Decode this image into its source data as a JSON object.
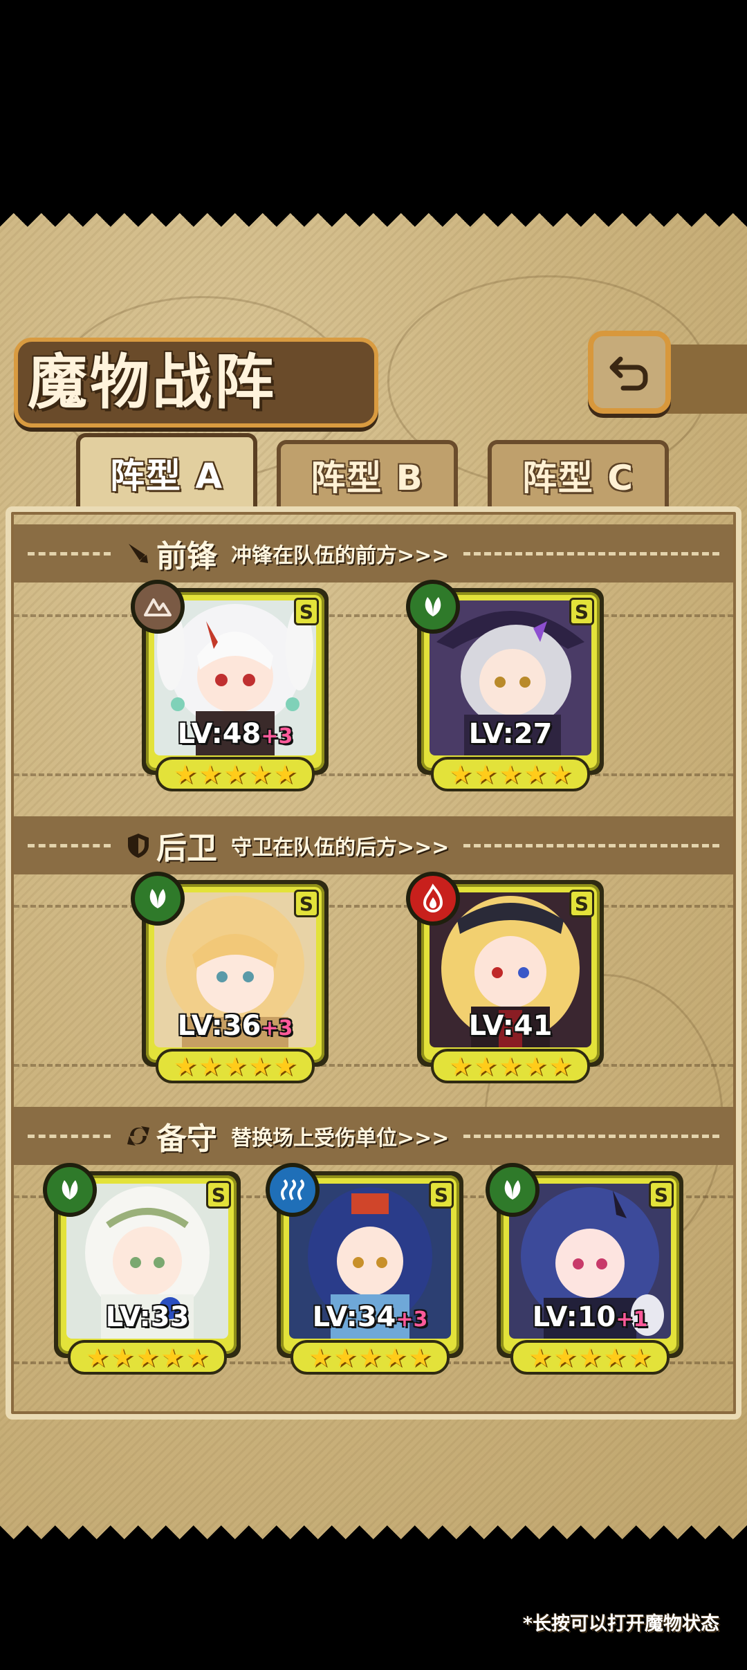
{
  "title": "魔物战阵",
  "back_button": {
    "icon": "back-arrow-icon"
  },
  "tabs": [
    {
      "label": "阵型",
      "suffix": "A",
      "active": true
    },
    {
      "label": "阵型",
      "suffix": "B",
      "active": false
    },
    {
      "label": "阵型",
      "suffix": "C",
      "active": false
    }
  ],
  "sections": {
    "front": {
      "name": "前锋",
      "desc": "冲锋在队伍的前方>>>",
      "icon": "sword-icon"
    },
    "rear": {
      "name": "后卫",
      "desc": "守卫在队伍的后方>>>",
      "icon": "shield-icon"
    },
    "reserve": {
      "name": "备守",
      "desc": "替换场上受伤单位>>>",
      "icon": "swap-icon"
    }
  },
  "units": {
    "front_1": {
      "level": "LV:48",
      "bonus": "+3",
      "rank": "S",
      "element": "earth",
      "element_color": "#7a5a44",
      "stars": 5
    },
    "front_2": {
      "level": "LV:27",
      "bonus": "",
      "rank": "S",
      "element": "wood",
      "element_color": "#2f7a2a",
      "stars": 5
    },
    "rear_1": {
      "level": "LV:36",
      "bonus": "+3",
      "rank": "S",
      "element": "wood",
      "element_color": "#2f7a2a",
      "stars": 5
    },
    "rear_2": {
      "level": "LV:41",
      "bonus": "",
      "rank": "S",
      "element": "fire",
      "element_color": "#c8201c",
      "stars": 5
    },
    "reserve_1": {
      "level": "LV:33",
      "bonus": "",
      "rank": "S",
      "element": "wood",
      "element_color": "#2f7a2a",
      "stars": 5
    },
    "reserve_2": {
      "level": "LV:34",
      "bonus": "+3",
      "rank": "S",
      "element": "water",
      "element_color": "#1f6fb8",
      "stars": 5
    },
    "reserve_3": {
      "level": "LV:10",
      "bonus": "+1",
      "rank": "S",
      "element": "wood",
      "element_color": "#2f7a2a",
      "stars": 5
    }
  },
  "footnote": "*长按可以打开魔物状态",
  "colors": {
    "card_border": "#e3e23a",
    "panel": "#cdb580",
    "banner": "#8a6d44",
    "star": "#ffcc1a",
    "bonus": "#ff5a9a"
  }
}
